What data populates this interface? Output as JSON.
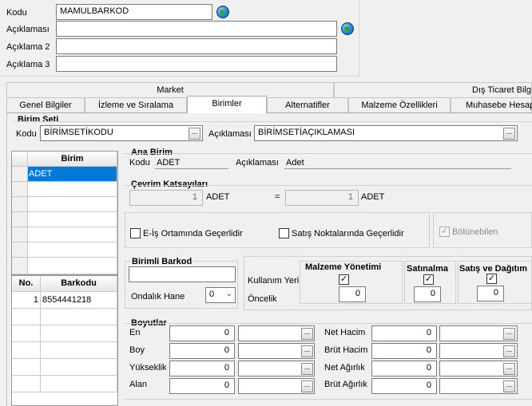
{
  "header": {
    "kodu_label": "Kodu",
    "kodu_value": "MAMULBARKOD",
    "aciklamasi_label": "Açıklaması",
    "aciklamasi_value": "",
    "aciklama2_label": "Açıklama 2",
    "aciklama2_value": "",
    "aciklama3_label": "Açıklama 3",
    "aciklama3_value": ""
  },
  "tabs": {
    "top_row": [
      "Market",
      "Dış Ticaret Bilg"
    ],
    "bottom_row": [
      "Genel Bilgiler",
      "İzleme ve Sıralama",
      "Birimler",
      "Alternatifler",
      "Malzeme Özellikleri",
      "Muhasebe Hesap"
    ],
    "active": "Birimler"
  },
  "birim_seti": {
    "title": "Birim Seti",
    "kodu_label": "Kodu",
    "kodu_value": "BİRİMSETİKODU",
    "aciklamasi_label": "Açıklaması",
    "aciklamasi_value": "BİRİMSETİAÇIKLAMASI",
    "lookup_glyph": "..."
  },
  "birim_grid": {
    "header": "Birim",
    "rows": [
      "ADET"
    ]
  },
  "barkod_grid": {
    "headers": [
      "No.",
      "Barkodu"
    ],
    "rows": [
      {
        "no": "1",
        "barkod": "8554441218"
      }
    ]
  },
  "ana_birim": {
    "title": "Ana Birim",
    "kodu_label": "Kodu",
    "kodu_value": "ADET",
    "aciklamasi_label": "Açıklaması",
    "aciklamasi_value": "Adet"
  },
  "cevrim": {
    "title": "Çevrim Katsayıları",
    "left_value": "1",
    "left_unit": "ADET",
    "equals": "=",
    "right_value": "1",
    "right_unit": "ADET"
  },
  "flags": {
    "eis_label": "E-İş Ortamında Geçerlidir",
    "eis_checked": false,
    "satis_label": "Satış Noktalarında Geçerlidir",
    "satis_checked": false,
    "bolunebilen_label": "Bölünebilen",
    "bolunebilen_checked": true
  },
  "birimli_barkod": {
    "title": "Birimli Barkod",
    "value": "",
    "ondalik_label": "Ondalık Hane",
    "ondalik_value": "0"
  },
  "kullanim": {
    "kullanim_label": "Kullanım Yeri",
    "oncelik_label": "Öncelik",
    "columns": [
      {
        "label": "Malzeme Yönetimi",
        "checked": true,
        "priority": "0"
      },
      {
        "label": "Satınalma",
        "checked": true,
        "priority": "0"
      },
      {
        "label": "Satış ve Dağıtım",
        "checked": true,
        "priority": "0"
      }
    ]
  },
  "boyutlar": {
    "title": "Boyutlar",
    "left": [
      {
        "label": "En",
        "value": "0"
      },
      {
        "label": "Boy",
        "value": "0"
      },
      {
        "label": "Yükseklik",
        "value": "0"
      },
      {
        "label": "Alan",
        "value": "0"
      }
    ],
    "right": [
      {
        "label": "Net Hacim",
        "value": "0"
      },
      {
        "label": "Brüt Hacim",
        "value": "0"
      },
      {
        "label": "Net Ağırlık",
        "value": "0"
      },
      {
        "label": "Brüt Ağırlık",
        "value": "0"
      }
    ]
  },
  "icons": {
    "globe": "globe-icon",
    "lookup": "ellipsis-icon",
    "check": "checkmark-icon",
    "dropdown": "chevron-down-icon"
  }
}
